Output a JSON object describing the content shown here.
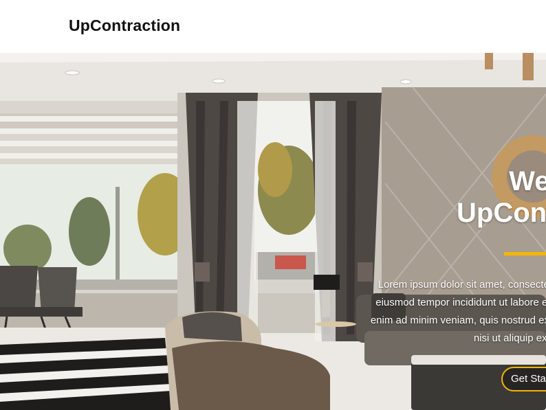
{
  "header": {
    "brand": "UpContraction"
  },
  "hero": {
    "title_line1": "Welcome to",
    "title_line2": "UpConstraction",
    "desc_line1": "Lorem ipsum dolor sit amet, consectetur adipiscing elit, sed do",
    "desc_line2": "eiusmod tempor incididunt ut labore et dolore magna aliqua. Ut",
    "desc_line3": "enim ad minim veniam, quis nostrud exercitation ullamco laboris",
    "desc_line4": "nisi ut aliquip ex ea commodo consequat.",
    "cta_label": "Get Started",
    "accent_color": "#f2b705"
  }
}
